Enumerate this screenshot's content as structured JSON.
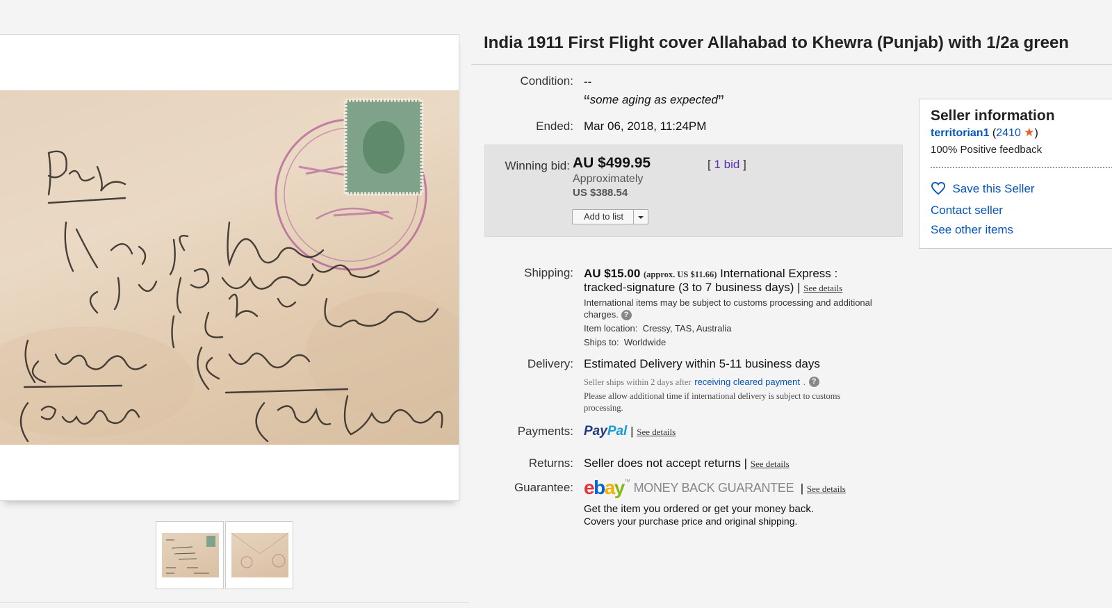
{
  "item": {
    "title": "India 1911 First Flight cover Allahabad to Khewra (Punjab) with 1/2a green"
  },
  "condition": {
    "label": "Condition:",
    "value": "--",
    "note": "some aging as expected",
    "open_quote": "“",
    "close_quote": "”"
  },
  "ended": {
    "label": "Ended:",
    "date": "Mar 06, 2018",
    "sep": ",",
    "time": "11:24PM"
  },
  "bid": {
    "label": "Winning bid:",
    "price": "AU $499.95",
    "approx_label": "Approximately",
    "usd_price": "US $388.54",
    "bid_prefix": "[",
    "bid_count": "1 bid",
    "bid_suffix": "]",
    "add_to_list": "Add to list"
  },
  "shipping": {
    "label": "Shipping:",
    "price": "AU $15.00",
    "approx": "(approx. US $11.66)",
    "service_line1": "International Express :",
    "service_line2": "tracked-signature (3 to 7 business days)",
    "pipe": "|",
    "see_details": "See details",
    "customs_note_line1": "International items may be subject to customs processing and additional",
    "customs_note_line2": "charges.",
    "location_label": "Item location:",
    "location": "Cressy, TAS, Australia",
    "ships_to_label": "Ships to:",
    "ships_to": "Worldwide"
  },
  "delivery": {
    "label": "Delivery:",
    "estimate": "Estimated Delivery within 5-11 business days",
    "handling_prefix": "Seller ships within 2 days after",
    "handling_link": "receiving cleared payment",
    "handling_suffix": ".",
    "note_line1": "Please allow additional time if international delivery is subject to customs",
    "note_line2": "processing."
  },
  "payments": {
    "label": "Payments:",
    "paypal_part1": "Pay",
    "paypal_part2": "Pal",
    "pipe": "|",
    "see_details": "See details"
  },
  "returns": {
    "label": "Returns:",
    "value": "Seller does not accept returns",
    "pipe": "|",
    "see_details": "See details"
  },
  "guarantee": {
    "label": "Guarantee:",
    "ebay_letters": [
      "e",
      "b",
      "a",
      "y"
    ],
    "tm": "™",
    "mbg": "MONEY BACK GUARANTEE",
    "pipe": "|",
    "see_details": "See details",
    "line1": "Get the item you ordered or get your money back.",
    "line2": "Covers your purchase price and original shipping."
  },
  "seller": {
    "heading": "Seller information",
    "username": "territorian1",
    "open_paren": "(",
    "feedback_score": "2410",
    "close_paren": ")",
    "positive": "100% Positive feedback",
    "save": "Save this Seller",
    "contact": "Contact seller",
    "other_items": "See other items"
  },
  "colors": {
    "link": "#0654ba",
    "star": "#e0632a",
    "ebay_e": "#e53238",
    "ebay_b": "#0064d2",
    "ebay_a": "#f5af02",
    "ebay_y": "#86b817",
    "bid_link": "#5c2fb1"
  },
  "icons": [
    "heart-icon",
    "star-icon",
    "help-icon",
    "dropdown-arrow-icon"
  ]
}
